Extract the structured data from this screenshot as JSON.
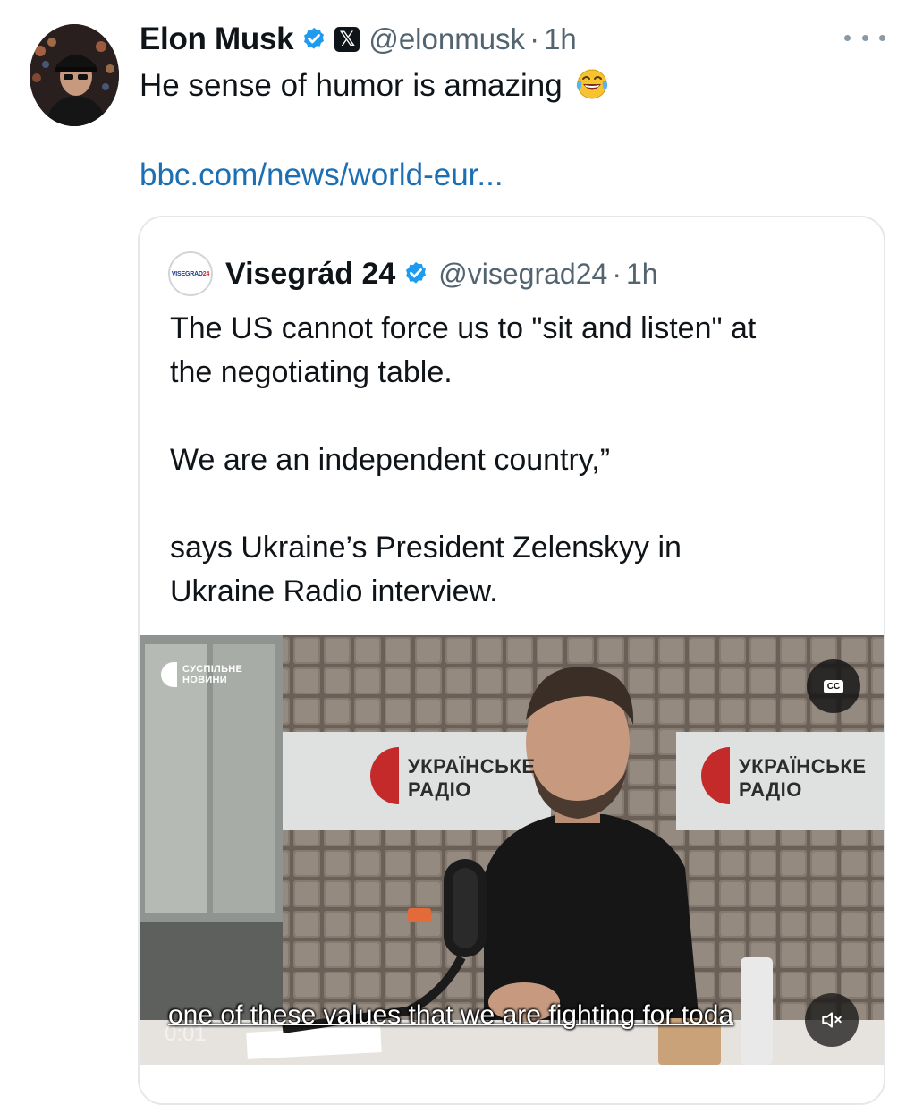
{
  "tweet": {
    "author_name": "Elon Musk",
    "handle": "@elonmusk",
    "separator": "·",
    "time": "1h",
    "text": "He sense of humor is amazing",
    "emoji": "face-with-tears-of-joy",
    "link": "bbc.com/news/world-eur..."
  },
  "quote": {
    "avatar_text_part1": "VISEGRAD",
    "avatar_text_part2": "24",
    "author_name": "Visegrád 24",
    "handle": "@visegrad24",
    "separator": "·",
    "time": "1h",
    "text_lines": [
      "The US cannot force us to \"sit and listen\" at",
      "the negotiating table.",
      "We are an independent country,”",
      "says Ukraine’s President Zelenskyy in",
      "Ukraine Radio interview."
    ]
  },
  "video": {
    "broadcaster_line1": "СУСПІЛЬНЕ",
    "broadcaster_line2": "НОВИНИ",
    "cc_label": "CC",
    "sign_left_line1": "УКРАЇНСЬКЕ",
    "sign_left_line2": "РАДІО",
    "sign_right_line1": "УКРАЇНСЬКЕ",
    "sign_right_line2": "РАДІО",
    "subtitle": "one of these values that we are fighting for toda",
    "timecode": "0:01"
  },
  "colors": {
    "link": "#1d6fb4",
    "verified": "#1d9bf0",
    "secondary_text": "#536471"
  },
  "icons": {
    "verified": "verified-badge-icon",
    "x_badge": "x-logo-icon",
    "more": "more-horizontal-icon",
    "cc": "closed-captions-icon",
    "mute": "speaker-muted-icon"
  }
}
